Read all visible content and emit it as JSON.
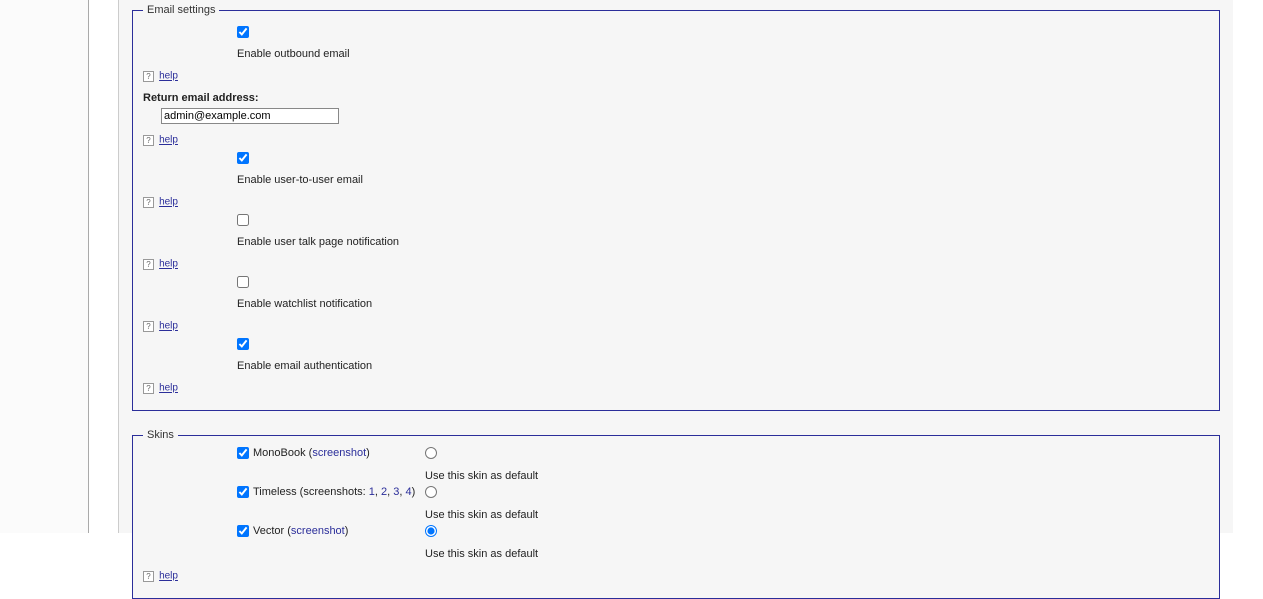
{
  "help_text": "help",
  "email": {
    "legend": "Email settings",
    "outbound": {
      "label": "Enable outbound email",
      "checked": true
    },
    "return_address_label": "Return email address:",
    "return_address_value": "admin@example.com",
    "user_to_user": {
      "label": "Enable user-to-user email",
      "checked": true
    },
    "talk_notification": {
      "label": "Enable user talk page notification",
      "checked": false
    },
    "watchlist_notification": {
      "label": "Enable watchlist notification",
      "checked": false
    },
    "authentication": {
      "label": "Enable email authentication",
      "checked": true
    }
  },
  "skins": {
    "legend": "Skins",
    "default_label": "Use this skin as default",
    "screenshot_link_text": "screenshot",
    "screenshots_prefix": "screenshots: ",
    "items": [
      {
        "name": "MonoBook",
        "enabled": true,
        "default": false,
        "links": [
          "screenshot"
        ]
      },
      {
        "name": "Timeless",
        "enabled": true,
        "default": false,
        "link_numbers": [
          "1",
          "2",
          "3",
          "4"
        ]
      },
      {
        "name": "Vector",
        "enabled": true,
        "default": true,
        "links": [
          "screenshot"
        ]
      }
    ]
  },
  "colors": {
    "accent": "#2b2e9a"
  }
}
